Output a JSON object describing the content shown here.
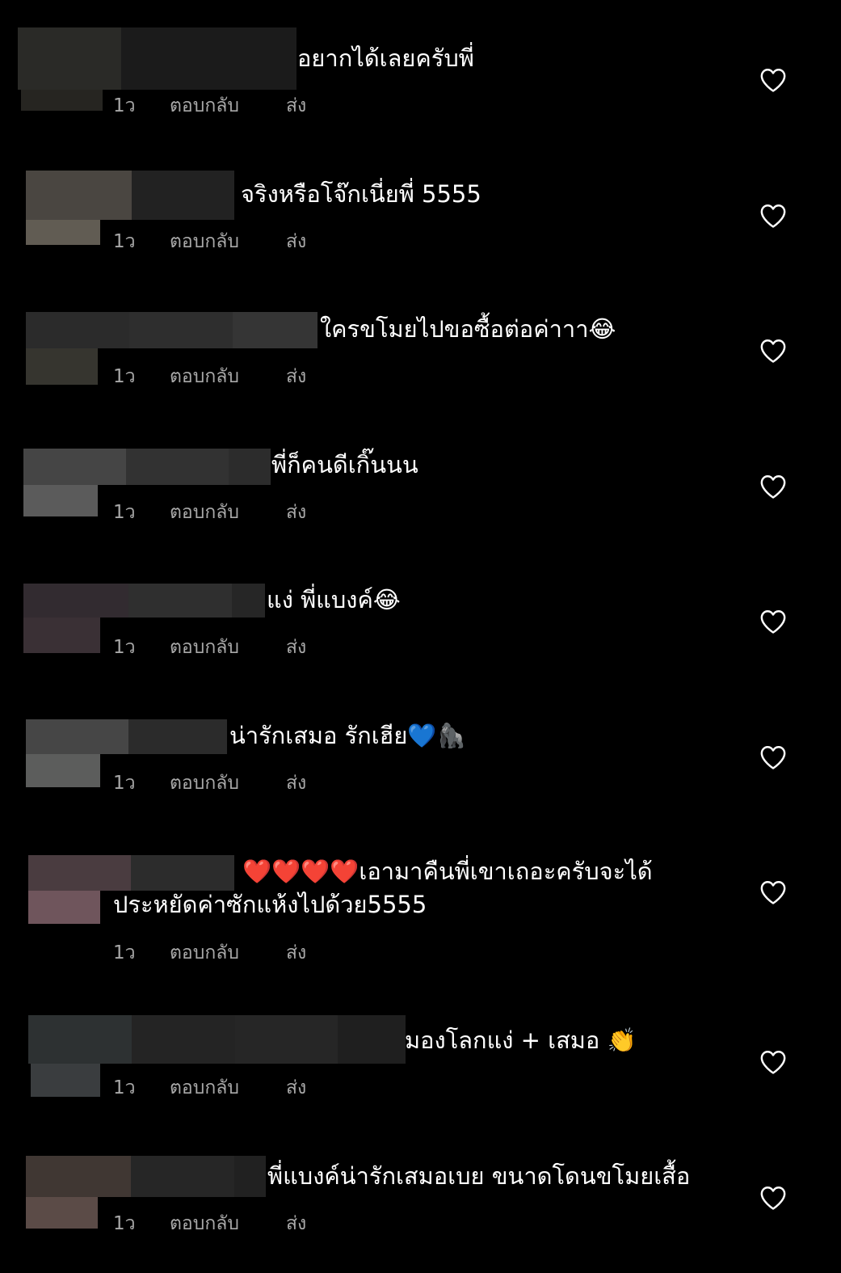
{
  "comments": [
    {
      "text": "อยากได้เลยครับพี่",
      "time": "1ว",
      "reply_label": "ตอบกลับ",
      "share_label": "ส่ง"
    },
    {
      "text": "จริงหรือโจ๊กเนี่ยพี่ 5555",
      "time": "1ว",
      "reply_label": "ตอบกลับ",
      "share_label": "ส่ง"
    },
    {
      "text": "ใครขโมยไปขอซื้อต่อค่าาา😂",
      "time": "1ว",
      "reply_label": "ตอบกลับ",
      "share_label": "ส่ง"
    },
    {
      "text": "พี่ก็คนดีเกิ๊นนน",
      "time": "1ว",
      "reply_label": "ตอบกลับ",
      "share_label": "ส่ง"
    },
    {
      "text": "แง่ พี่แบงค์😂",
      "time": "1ว",
      "reply_label": "ตอบกลับ",
      "share_label": "ส่ง"
    },
    {
      "text": "น่ารักเสมอ รักเฮีย💙🦍",
      "time": "1ว",
      "reply_label": "ตอบกลับ",
      "share_label": "ส่ง"
    },
    {
      "text_line1": "❤️❤️❤️❤️เอามาคืนพี่เขาเถอะครับจะได้",
      "text_line2": "ประหยัดค่าซักแห้งไปด้วย5555",
      "time": "1ว",
      "reply_label": "ตอบกลับ",
      "share_label": "ส่ง"
    },
    {
      "text": "มองโลกแง่ + เสมอ 👏",
      "time": "1ว",
      "reply_label": "ตอบกลับ",
      "share_label": "ส่ง"
    },
    {
      "text": "พี่แบงค์น่ารักเสมอเบย ขนาดโดนขโมยเสื้อ",
      "time": "1ว",
      "reply_label": "ตอบกลับ",
      "share_label": "ส่ง"
    }
  ],
  "colors": {
    "background": "#000000",
    "text": "#ffffff",
    "meta": "#a8a8a8"
  }
}
